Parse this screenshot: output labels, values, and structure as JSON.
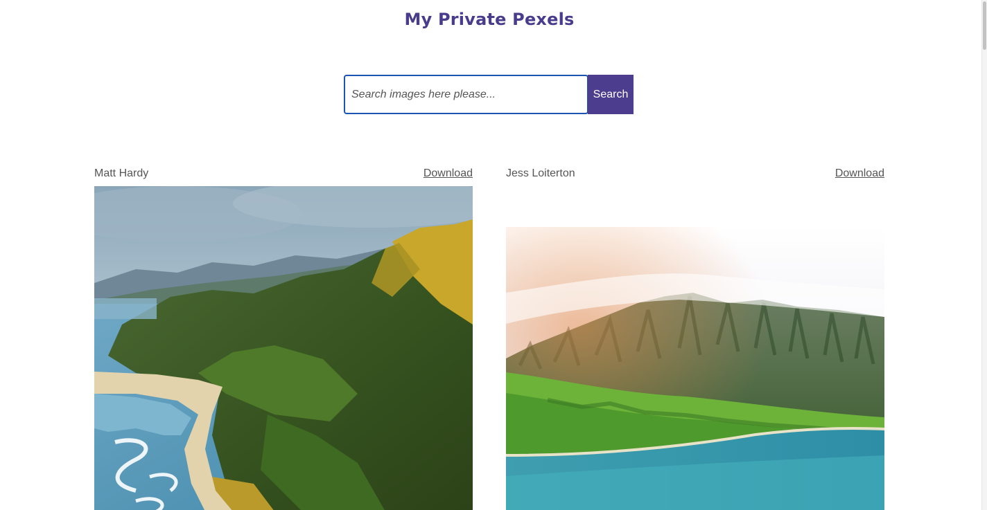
{
  "header": {
    "title": "My Private Pexels"
  },
  "search": {
    "placeholder": "Search images here please...",
    "button_label": "Search"
  },
  "photos": [
    {
      "author": "Matt Hardy",
      "download_label": "Download"
    },
    {
      "author": "Jess Loiterton",
      "download_label": "Download"
    }
  ],
  "colors": {
    "accent": "#4c3d8f",
    "title": "#4a3c8c",
    "input_border": "#1a55b5"
  }
}
